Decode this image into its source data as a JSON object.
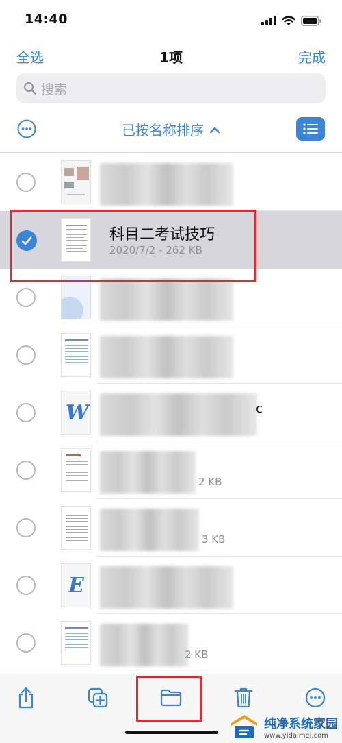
{
  "status_bar": {
    "time": "14:40"
  },
  "nav": {
    "select_all": "全选",
    "title": "1项",
    "done": "完成"
  },
  "search": {
    "placeholder": "搜索"
  },
  "sort": {
    "label": "已按名称排序"
  },
  "files": [
    {
      "name": "",
      "meta": "",
      "selected": false,
      "thumb": "image-doc"
    },
    {
      "name": "科目二考试技巧",
      "meta": "2020/7/2 - 262 KB",
      "selected": true,
      "thumb": "text-doc"
    },
    {
      "name": "",
      "meta": "",
      "selected": false,
      "thumb": "blue-doc"
    },
    {
      "name": "",
      "meta": "",
      "selected": false,
      "thumb": "table-doc"
    },
    {
      "name": "c",
      "meta": "",
      "selected": false,
      "thumb": "word-doc",
      "icon_letter": "W"
    },
    {
      "name": "",
      "meta": "2 KB",
      "selected": false,
      "thumb": "text-doc"
    },
    {
      "name": "",
      "meta": "3 KB",
      "selected": false,
      "thumb": "text-doc"
    },
    {
      "name": "",
      "meta": "",
      "selected": false,
      "thumb": "excel-doc",
      "icon_letter": "E"
    },
    {
      "name": "",
      "meta": "2 KB",
      "selected": false,
      "thumb": "table-doc"
    }
  ],
  "toolbar": {
    "items": [
      "share-icon",
      "duplicate-icon",
      "folder-icon",
      "trash-icon",
      "more-icon"
    ]
  },
  "watermark": {
    "title": "纯净系统家园",
    "url": "www.yidaimei.com"
  },
  "colors": {
    "accent": "#3a86d6",
    "highlight_box": "#e02a36",
    "selected_row": "#d7d6dc"
  }
}
